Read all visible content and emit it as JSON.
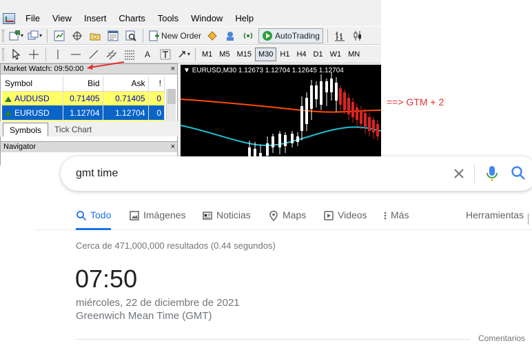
{
  "mt4": {
    "menu": [
      "File",
      "View",
      "Insert",
      "Charts",
      "Tools",
      "Window",
      "Help"
    ],
    "toolbar": {
      "new_order": "New Order",
      "auto_trading": "AutoTrading"
    },
    "timeframes": [
      "M1",
      "M5",
      "M15",
      "M30",
      "H1",
      "H4",
      "D1",
      "W1",
      "MN"
    ],
    "active_timeframe": "M30",
    "market_watch": {
      "title": "Market Watch: 09:50:00",
      "close": "×",
      "columns": [
        "Symbol",
        "Bid",
        "Ask",
        "!"
      ],
      "rows": [
        {
          "symbol": "AUDUSD",
          "bid": "0.71405",
          "ask": "0.71405",
          "spread": "0"
        },
        {
          "symbol": "EURUSD",
          "bid": "1.12704",
          "ask": "1.12704",
          "spread": "0"
        }
      ],
      "tabs": [
        "Symbols",
        "Tick Chart"
      ]
    },
    "navigator": {
      "title": "Navigator",
      "close": "×"
    },
    "chart": {
      "title": "EURUSD,M30  1.12673 1.12704 1.12645 1.12704"
    }
  },
  "annotation": {
    "note": "==> GTM + 2"
  },
  "google": {
    "query": "gmt time",
    "tabs": [
      "Todo",
      "Imágenes",
      "Noticias",
      "Maps",
      "Videos",
      "Más"
    ],
    "tools": "Herramientas",
    "stats": "Cerca de 471,000,000 resultados (0.44 segundos)",
    "time": "07:50",
    "date": "miércoles, 22 de diciembre de 2021",
    "timezone": "Greenwich Mean Time (GMT)",
    "feedback": "Comentarios"
  },
  "colors": {
    "accent": "#1a73e8",
    "annotation": "#e03030",
    "bull": "#ffffff",
    "bear": "#e02020",
    "ma_slow": "#ff4d00",
    "ma_fast": "#20c0d0"
  }
}
